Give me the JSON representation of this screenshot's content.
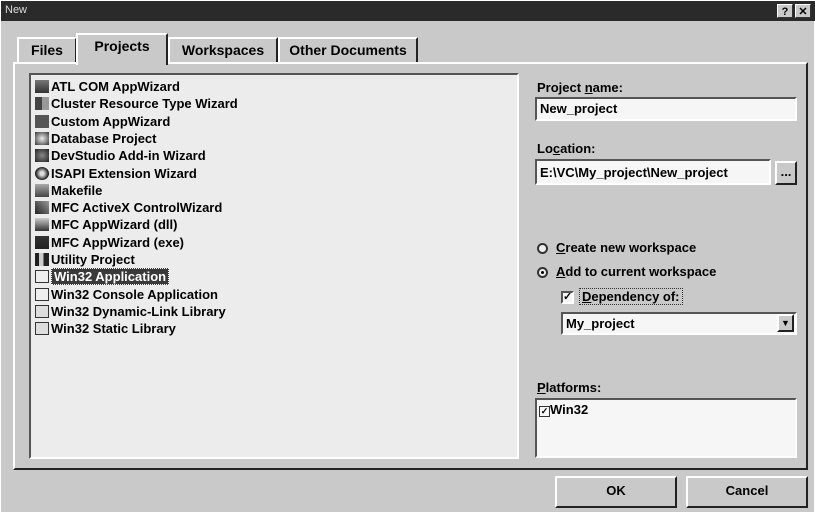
{
  "window": {
    "title": "New",
    "help_glyph": "?",
    "close_glyph": "✕"
  },
  "tabs": [
    {
      "label": "Files",
      "active": false
    },
    {
      "label": "Projects",
      "active": true
    },
    {
      "label": "Workspaces",
      "active": false
    },
    {
      "label": "Other Documents",
      "active": false
    }
  ],
  "project_types": [
    {
      "label": "ATL COM AppWizard",
      "icon": "atl-icon"
    },
    {
      "label": "Cluster Resource Type Wizard",
      "icon": "cluster-icon"
    },
    {
      "label": "Custom AppWizard",
      "icon": "custom-wizard-icon"
    },
    {
      "label": "Database Project",
      "icon": "database-icon"
    },
    {
      "label": "DevStudio Add-in Wizard",
      "icon": "addin-icon"
    },
    {
      "label": "ISAPI Extension Wizard",
      "icon": "globe-icon"
    },
    {
      "label": "Makefile",
      "icon": "makefile-icon"
    },
    {
      "label": "MFC ActiveX ControlWizard",
      "icon": "activex-icon"
    },
    {
      "label": "MFC AppWizard (dll)",
      "icon": "mfc-dll-icon"
    },
    {
      "label": "MFC AppWizard (exe)",
      "icon": "mfc-exe-icon"
    },
    {
      "label": "Utility Project",
      "icon": "utility-icon"
    },
    {
      "label": "Win32 Application",
      "icon": "win32-app-icon",
      "selected": true
    },
    {
      "label": "Win32 Console Application",
      "icon": "console-icon"
    },
    {
      "label": "Win32 Dynamic-Link Library",
      "icon": "dll-icon"
    },
    {
      "label": "Win32 Static Library",
      "icon": "lib-icon"
    }
  ],
  "project_name": {
    "label_pre": "Project ",
    "label_hot": "n",
    "label_post": "ame:",
    "value": "New_project"
  },
  "location": {
    "label_pre": "Lo",
    "label_hot": "c",
    "label_post": "ation:",
    "value": "E:\\VC\\My_project\\New_project",
    "browse_label": "..."
  },
  "workspace": {
    "create_new": {
      "hot": "C",
      "rest": "reate new workspace",
      "selected": false
    },
    "add_current": {
      "hot": "A",
      "rest": "dd to current workspace",
      "selected": true
    },
    "dependency": {
      "hot": "D",
      "rest": "ependency of:",
      "checked": true,
      "check_glyph": "✓"
    },
    "dependency_value": "My_project",
    "combo_arrow": "▼"
  },
  "platforms": {
    "label_hot": "P",
    "label_rest": "latforms:",
    "items": [
      {
        "label": "Win32",
        "checked": true,
        "check_glyph": "✓"
      }
    ]
  },
  "buttons": {
    "ok": "OK",
    "cancel": "Cancel"
  }
}
